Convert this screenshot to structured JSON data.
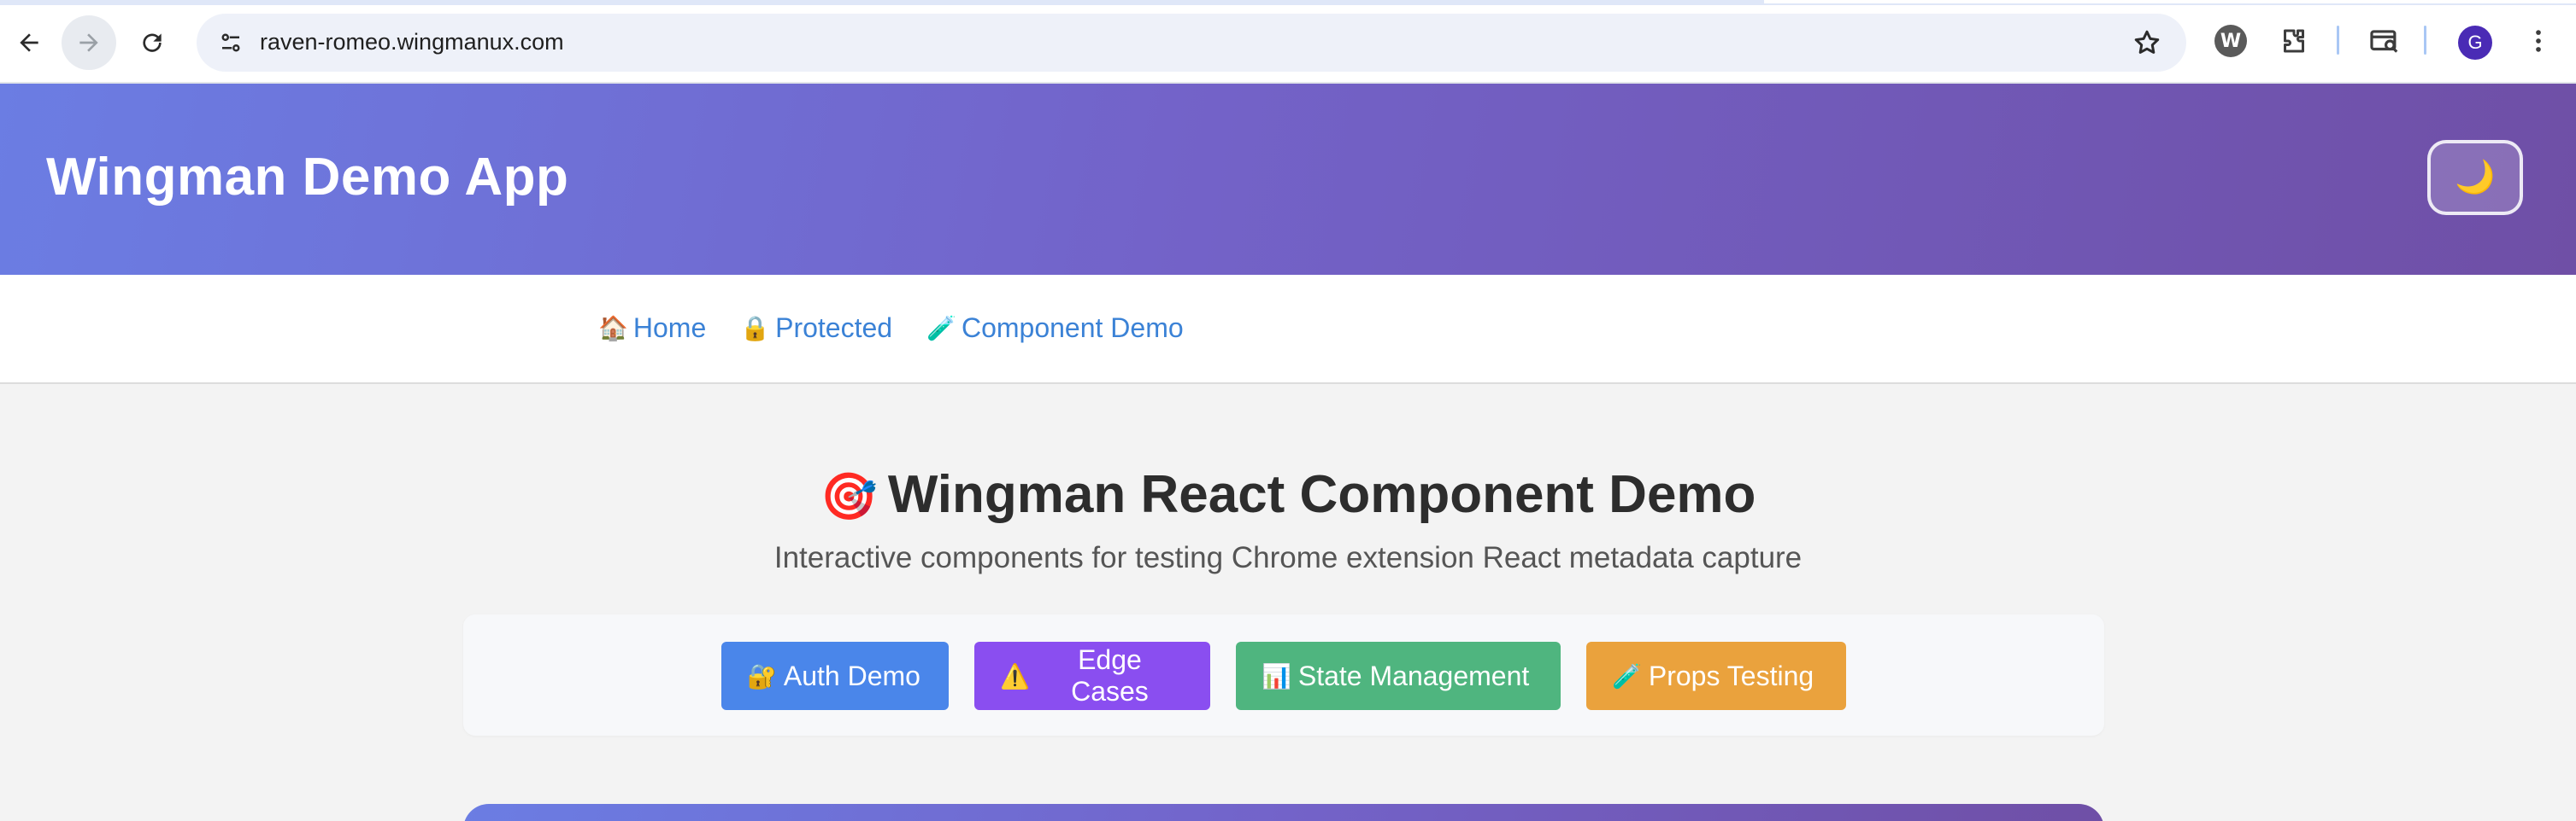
{
  "browser": {
    "url": "raven-romeo.wingmanux.com",
    "profile_initial": "G",
    "icons": [
      "back-icon",
      "forward-icon",
      "reload-icon",
      "site-info-icon",
      "bookmark-star-icon",
      "wingman-extension-icon",
      "extensions-puzzle-icon",
      "tab-search-icon",
      "menu-kebab-icon"
    ]
  },
  "header": {
    "title": "Wingman Demo App",
    "theme_toggle_glyph": "🌙"
  },
  "nav": {
    "links": [
      {
        "emoji": "🏠",
        "label": "Home"
      },
      {
        "emoji": "🔒",
        "label": "Protected"
      },
      {
        "emoji": "🧪",
        "label": "Component Demo"
      }
    ]
  },
  "main": {
    "title_emoji": "🎯",
    "title": "Wingman React Component Demo",
    "subtitle": "Interactive components for testing Chrome extension React metadata capture",
    "demo_buttons": [
      {
        "emoji": "🔐",
        "label": "Auth Demo",
        "color": "#4a86ea"
      },
      {
        "emoji": "⚠️",
        "label": "Edge Cases",
        "color": "#8a4ef0"
      },
      {
        "emoji": "📊",
        "label": "State Management",
        "color": "#4fb57f"
      },
      {
        "emoji": "🧪",
        "label": "Props Testing",
        "color": "#eaa23d"
      }
    ]
  },
  "colors": {
    "header_gradient_start": "#6b7de3",
    "header_gradient_end": "#6f4fa6",
    "link": "#3b82d6"
  }
}
